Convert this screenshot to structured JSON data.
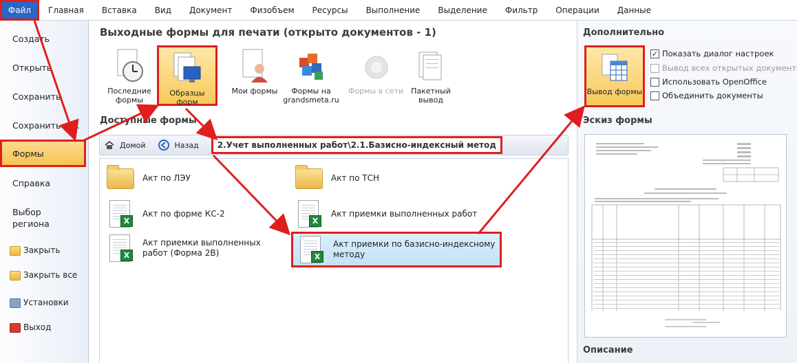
{
  "ribbon": {
    "file_tab": "Файл",
    "tabs": [
      "Главная",
      "Вставка",
      "Вид",
      "Документ",
      "Физобъем",
      "Ресурсы",
      "Выполнение",
      "Выделение",
      "Фильтр",
      "Операции",
      "Данные"
    ]
  },
  "leftmenu": {
    "items": [
      "Создать",
      "Открыть",
      "Сохранить",
      "Сохранить как",
      "Формы",
      "Справка"
    ],
    "region": "Выбор\nрегиона",
    "small_items": [
      "Закрыть",
      "Закрыть все",
      "Установки",
      "Выход"
    ]
  },
  "main": {
    "title": "Выходные формы для печати (открыто документов - 1)",
    "buttons": [
      {
        "label": "Последние формы",
        "icon": "clock-doc-icon"
      },
      {
        "label": "Образцы форм",
        "icon": "forms-sample-icon"
      },
      {
        "label": "Мои формы",
        "icon": "user-doc-icon"
      },
      {
        "label": "Формы на grandsmeta.ru",
        "icon": "web-forms-icon"
      },
      {
        "label": "Формы в сети",
        "icon": "network-icon"
      },
      {
        "label": "Пакетный вывод",
        "icon": "batch-doc-icon"
      }
    ],
    "available_title": "Доступные формы",
    "nav": {
      "home": "Домой",
      "back": "Назад",
      "path": "2.Учет выполненных работ\\2.1.Базисно-индексный метод"
    },
    "files": [
      {
        "label": "Акт по ЛЭУ",
        "type": "folder"
      },
      {
        "label": "Акт по ТСН",
        "type": "folder"
      },
      {
        "label": "Акт по форме КС-2",
        "type": "xls"
      },
      {
        "label": "Акт приемки выполненных работ",
        "type": "xls"
      },
      {
        "label": "Акт приемки выполненных работ (Форма 2В)",
        "type": "xls"
      },
      {
        "label": "Акт приемки по базисно-индексному методу",
        "type": "xls"
      }
    ]
  },
  "right": {
    "title": "Дополнительно",
    "print_label": "Вывод формы",
    "options": [
      {
        "label": "Показать диалог настроек",
        "checked": true,
        "enabled": true
      },
      {
        "label": "Вывод всех открытых документов",
        "checked": false,
        "enabled": false
      },
      {
        "label": "Использовать OpenOffice",
        "checked": false,
        "enabled": true
      },
      {
        "label": "Объединить документы",
        "checked": false,
        "enabled": true
      }
    ],
    "sketch_title": "Эскиз формы",
    "desc_title": "Описание"
  },
  "colors": {
    "accent": "#2b66c6",
    "highlight": "#f8c95b",
    "annotation": "#e01e1e"
  }
}
